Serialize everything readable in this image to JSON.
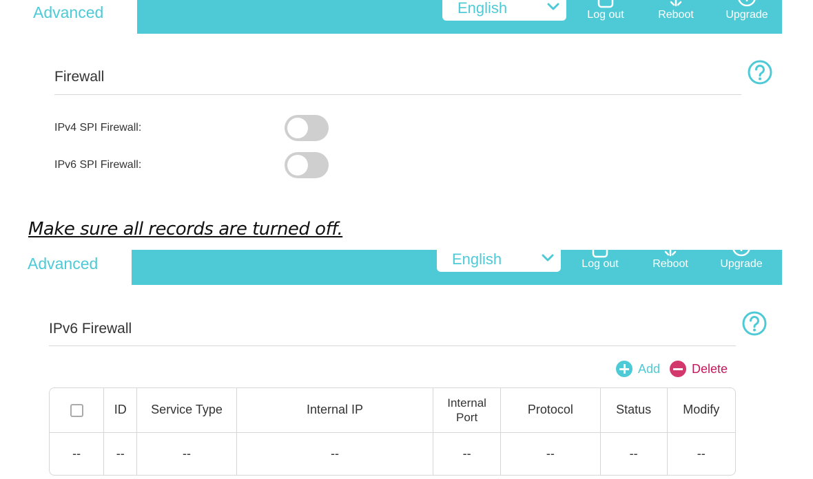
{
  "panel1": {
    "tab_label": "Advanced",
    "language": "English",
    "header_buttons": {
      "logout": "Log out",
      "reboot": "Reboot",
      "upgrade": "Upgrade"
    },
    "section_title": "Firewall",
    "fields": [
      {
        "label": "IPv4 SPI Firewall:",
        "enabled": false
      },
      {
        "label": "IPv6 SPI Firewall:",
        "enabled": false
      }
    ]
  },
  "caption": "Make sure all records are turned off.",
  "panel2": {
    "tab_label": "Advanced",
    "language": "English",
    "header_buttons": {
      "logout": "Log out",
      "reboot": "Reboot",
      "upgrade": "Upgrade"
    },
    "section_title": "IPv6 Firewall",
    "actions": {
      "add": "Add",
      "delete": "Delete"
    },
    "table": {
      "columns": [
        "ID",
        "Service Type",
        "Internal IP",
        "Internal Port",
        "Protocol",
        "Status",
        "Modify"
      ],
      "rows": [
        [
          "--",
          "--",
          "--",
          "--",
          "--",
          "--",
          "--",
          "--"
        ]
      ]
    }
  },
  "colors": {
    "accent": "#4ecad6",
    "delete": "#d2386c",
    "toggle_off": "#cfcfcf"
  },
  "icons": [
    "chevron-down-icon",
    "logout-icon",
    "reboot-icon",
    "upgrade-icon",
    "help-icon",
    "add-icon",
    "delete-icon"
  ]
}
